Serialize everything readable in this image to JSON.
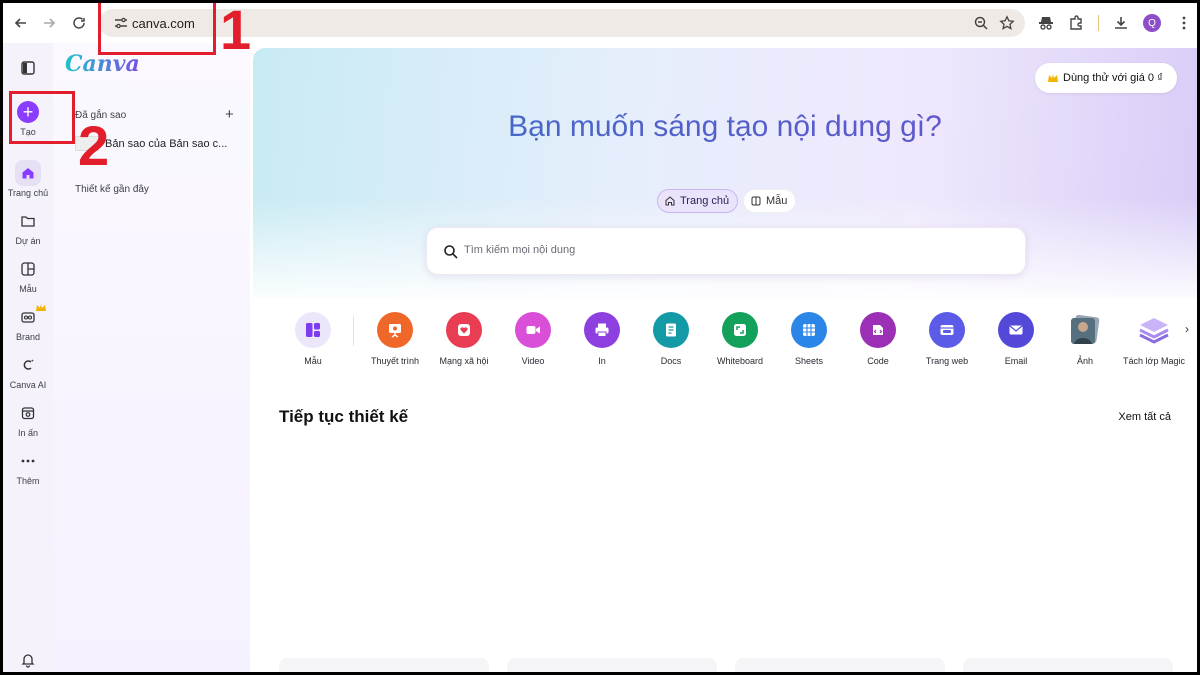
{
  "browser": {
    "url": "canva.com",
    "profile_initial": "Q"
  },
  "rail": {
    "items": [
      {
        "label": "Tạo"
      },
      {
        "label": "Trang chủ"
      },
      {
        "label": "Dự án"
      },
      {
        "label": "Mẫu"
      },
      {
        "label": "Brand"
      },
      {
        "label": "Canva AI"
      },
      {
        "label": "In ấn"
      },
      {
        "label": "Thêm"
      }
    ]
  },
  "panel": {
    "logo": "Canva",
    "starred_title": "Đã gắn sao",
    "starred_item": "Bản sao của Bản sao c...",
    "recent_title": "Thiết kế gần đây"
  },
  "main": {
    "trial_button": "Dùng thử với giá 0 ₫",
    "hero_title": "Bạn muốn sáng tạo nội dung gì?",
    "tabs": [
      {
        "label": "Trang chủ"
      },
      {
        "label": "Mẫu"
      }
    ],
    "search_placeholder": "Tìm kiếm mọi nội dung",
    "categories": [
      {
        "label": "Mẫu",
        "color": "#ece6fb"
      },
      {
        "label": "Thuyết trình",
        "color": "#f0672a"
      },
      {
        "label": "Mạng xã hội",
        "color": "#e93d54"
      },
      {
        "label": "Video",
        "color": "#d94fd7"
      },
      {
        "label": "In",
        "color": "#8e3fdf"
      },
      {
        "label": "Docs",
        "color": "#149aa6"
      },
      {
        "label": "Whiteboard",
        "color": "#13a05a"
      },
      {
        "label": "Sheets",
        "color": "#2b86e8"
      },
      {
        "label": "Code",
        "color": "#9b2fb5"
      },
      {
        "label": "Trang web",
        "color": "#5b5be8"
      },
      {
        "label": "Email",
        "color": "#5448d8"
      },
      {
        "label": "Ảnh",
        "color": "#7a8896"
      },
      {
        "label": "Tách lớp Magic",
        "color": "#a98bf0"
      }
    ],
    "continue_title": "Tiếp tục thiết kế",
    "see_all": "Xem tất cả"
  },
  "annotations": {
    "step1": "1",
    "step2": "2"
  }
}
